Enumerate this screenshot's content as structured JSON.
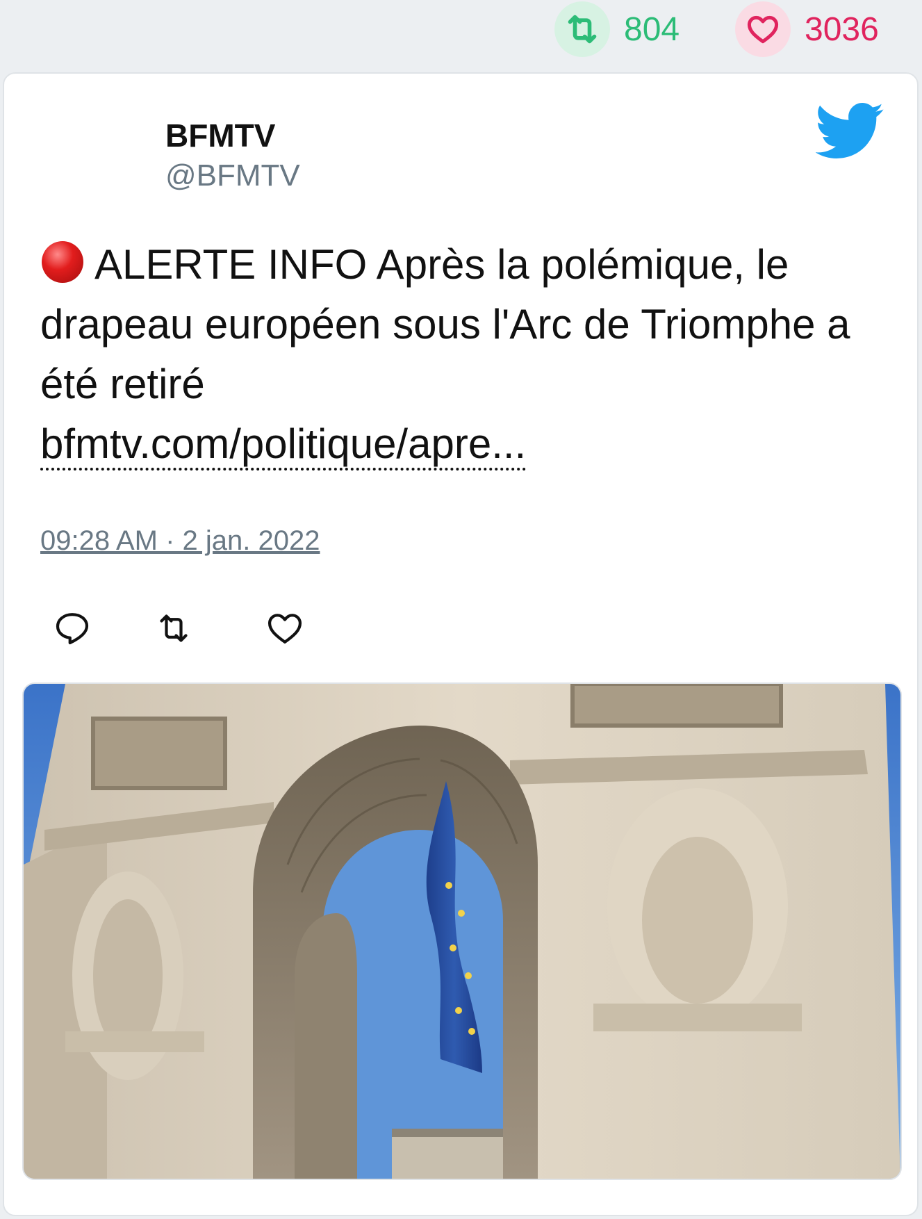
{
  "stats": {
    "retweets": "804",
    "likes": "3036",
    "retweet_icon": "retweet-icon",
    "like_icon": "heart-icon",
    "retweet_color": "#2cbc77",
    "like_color": "#e0245e"
  },
  "tweet": {
    "author_name": "BFMTV",
    "author_handle": "@BFMTV",
    "brand_icon": "twitter-bird-icon",
    "brand_color": "#1da1f2",
    "alert_icon": "red-circle-icon",
    "text": "ALERTE INFO Après la polémique, le drapeau européen sous l'Arc de Triomphe a été retiré",
    "link": "bfmtv.com/politique/apre...",
    "timestamp": "09:28 AM · 2 jan. 2022",
    "actions": [
      "reply-icon",
      "retweet-icon",
      "like-icon"
    ],
    "media": "photo-arc-de-triomphe-eu-flag"
  }
}
